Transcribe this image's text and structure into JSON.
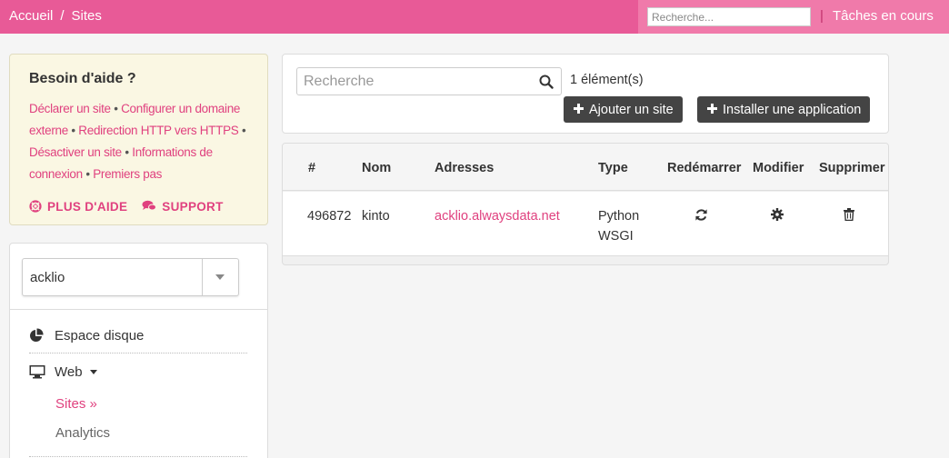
{
  "topbar": {
    "breadcrumb": [
      "Accueil",
      "Sites"
    ],
    "breadcrumb_sep": "/",
    "search_placeholder": "Recherche...",
    "separator": "|",
    "tasks_label": "Tâches en cours"
  },
  "help": {
    "title": "Besoin d'aide ?",
    "links": [
      "Déclarer un site",
      "Configurer un domaine externe",
      "Redirection HTTP vers HTTPS",
      "Désactiver un site",
      "Informations de connexion",
      "Premiers pas"
    ],
    "bullet": "•",
    "more_help": "PLUS D'AIDE",
    "support": "SUPPORT"
  },
  "sidebar": {
    "account": "acklio",
    "items": [
      {
        "label": "Espace disque",
        "icon": "pie-chart-icon"
      },
      {
        "label": "Web",
        "icon": "monitor-icon"
      }
    ],
    "sub_items": [
      {
        "label": "Sites »",
        "active": true
      },
      {
        "label": "Analytics",
        "active": false
      }
    ]
  },
  "main": {
    "search_placeholder": "Recherche",
    "count": "1 élément(s)",
    "add_site": "Ajouter un site",
    "install_app": "Installer une application"
  },
  "table": {
    "headers": [
      "#",
      "Nom",
      "Adresses",
      "Type",
      "Redémarrer",
      "Modifier",
      "Supprimer"
    ],
    "rows": [
      {
        "id": "496872",
        "name": "kinto",
        "address": "acklio.alwaysdata.net",
        "type_line1": "Python",
        "type_line2": "WSGI"
      }
    ]
  },
  "colors": {
    "brand": "#e85a97",
    "brand_light": "#f07aaa",
    "link": "#e0417f",
    "button": "#444444",
    "help_bg": "#faf7e3"
  }
}
